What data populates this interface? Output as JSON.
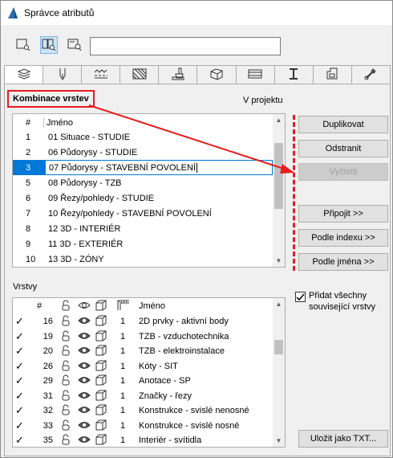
{
  "window": {
    "title": "Správce atributů"
  },
  "view_buttons": [
    {
      "icon": "list-view-icon"
    },
    {
      "icon": "dual-list-view-icon"
    },
    {
      "icon": "single-list-search-icon"
    }
  ],
  "search": {
    "value": ""
  },
  "tabs": [
    {
      "icon": "layers-tab-icon"
    },
    {
      "icon": "pen-tab-icon"
    },
    {
      "icon": "line-types-tab-icon"
    },
    {
      "icon": "fill-tab-icon"
    },
    {
      "icon": "paint-brush-tab-icon"
    },
    {
      "icon": "building-material-tab-icon"
    },
    {
      "icon": "composite-tab-icon"
    },
    {
      "icon": "profile-tab-icon"
    },
    {
      "icon": "zone-tab-icon"
    },
    {
      "icon": "surface-tab-icon"
    }
  ],
  "combinations": {
    "label": "Kombinace vrstev",
    "context_label": "V projektu",
    "columns": {
      "num": "#",
      "name": "Jméno"
    },
    "rows": [
      {
        "num": "1",
        "name": "01 Situace - STUDIE"
      },
      {
        "num": "2",
        "name": "06 Půdorysy - STUDIE"
      },
      {
        "num": "3",
        "name": "07 Půdorysy - STAVEBNÍ POVOLENÍ",
        "selected": true
      },
      {
        "num": "5",
        "name": "08 Půdorysy - TZB"
      },
      {
        "num": "6",
        "name": "09 Řezy/pohledy - STUDIE"
      },
      {
        "num": "7",
        "name": "10 Řezy/pohledy - STAVEBNÍ POVOLENÍ"
      },
      {
        "num": "8",
        "name": "12 3D - INTERIÉR"
      },
      {
        "num": "9",
        "name": "11 3D - EXTERIÉR"
      },
      {
        "num": "10",
        "name": "13 3D - ZÓNY"
      }
    ]
  },
  "actions": {
    "duplicate": "Duplikovat",
    "delete": "Odstranit",
    "purge": "Vyčistit",
    "append": "Připojit >>",
    "by_index": "Podle indexu >>",
    "by_name": "Podle jména >>",
    "save_txt": "Uložit jako TXT..."
  },
  "add_related": {
    "label": "Přidat všechny související vrstvy",
    "checked": true
  },
  "layers": {
    "label": "Vrstvy",
    "columns": {
      "num": "#",
      "name": "Jméno",
      "icons": [
        "lock-icon",
        "visibility-eye-icon",
        "wireframe-solid-icon",
        "intersection-group-icon"
      ]
    },
    "rows": [
      {
        "check": "✓",
        "num": "16",
        "pen": "1",
        "name": "2D prvky - aktivní body"
      },
      {
        "check": "✓",
        "num": "19",
        "pen": "1",
        "name": "TZB - vzduchotechnika"
      },
      {
        "check": "✓",
        "num": "20",
        "pen": "1",
        "name": "TZB - elektroinstalace"
      },
      {
        "check": "✓",
        "num": "26",
        "pen": "1",
        "name": "Kóty - SIT"
      },
      {
        "check": "✓",
        "num": "29",
        "pen": "1",
        "name": "Anotace - SP"
      },
      {
        "check": "✓",
        "num": "31",
        "pen": "1",
        "name": "Značky - řezy"
      },
      {
        "check": "✓",
        "num": "32",
        "pen": "1",
        "name": "Konstrukce - svislé nenosné"
      },
      {
        "check": "✓",
        "num": "33",
        "pen": "1",
        "name": "Konstrukce - svislé nosné"
      },
      {
        "check": "✓",
        "num": "35",
        "pen": "1",
        "name": "Interiér - svítidla"
      }
    ]
  },
  "colors": {
    "accent": "#0078d7",
    "annotation_red": "#e81c1c"
  }
}
